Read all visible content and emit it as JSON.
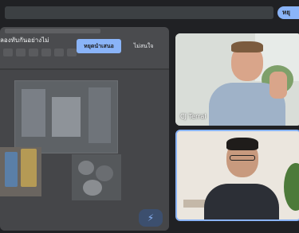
{
  "banner": {
    "text": "ลองทับกันอย่างไม่",
    "primary_button": "หยุดนำเสนอ",
    "secondary_button": "ไม่สนใจ"
  },
  "top_right_pill": "หยุ",
  "participants": [
    {
      "name": "CJ Terral"
    },
    {
      "name": ""
    }
  ],
  "icons": {
    "fab": "sparkle-icon"
  },
  "colors": {
    "accent": "#8ab4f8",
    "background": "#202124"
  }
}
